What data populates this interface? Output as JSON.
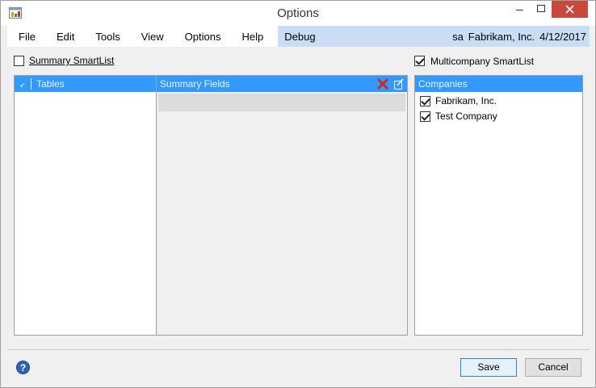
{
  "window": {
    "title": "Options",
    "controls": {
      "minimize": "–",
      "maximize": "□",
      "close": "✕"
    }
  },
  "menu": {
    "items": [
      "File",
      "Edit",
      "Tools",
      "View",
      "Options",
      "Help",
      "Debug"
    ],
    "user": "sa",
    "company": "Fabrikam, Inc.",
    "date": "4/12/2017"
  },
  "summary_smartlist": {
    "label": "Summary SmartList",
    "checked": false
  },
  "multicompany_smartlist": {
    "label": "Multicompany SmartList",
    "checked": true
  },
  "tables_panel": {
    "header": "Tables"
  },
  "summary_fields_panel": {
    "header": "Summary Fields"
  },
  "companies_panel": {
    "header": "Companies",
    "items": [
      {
        "label": "Fabrikam, Inc.",
        "checked": true
      },
      {
        "label": "Test Company",
        "checked": true
      }
    ]
  },
  "footer": {
    "help_icon": "?",
    "save_label": "Save",
    "cancel_label": "Cancel"
  },
  "colors": {
    "header_blue": "#3399ff",
    "menu_bar_blue": "#c9ddf5",
    "close_red": "#c7493b"
  }
}
